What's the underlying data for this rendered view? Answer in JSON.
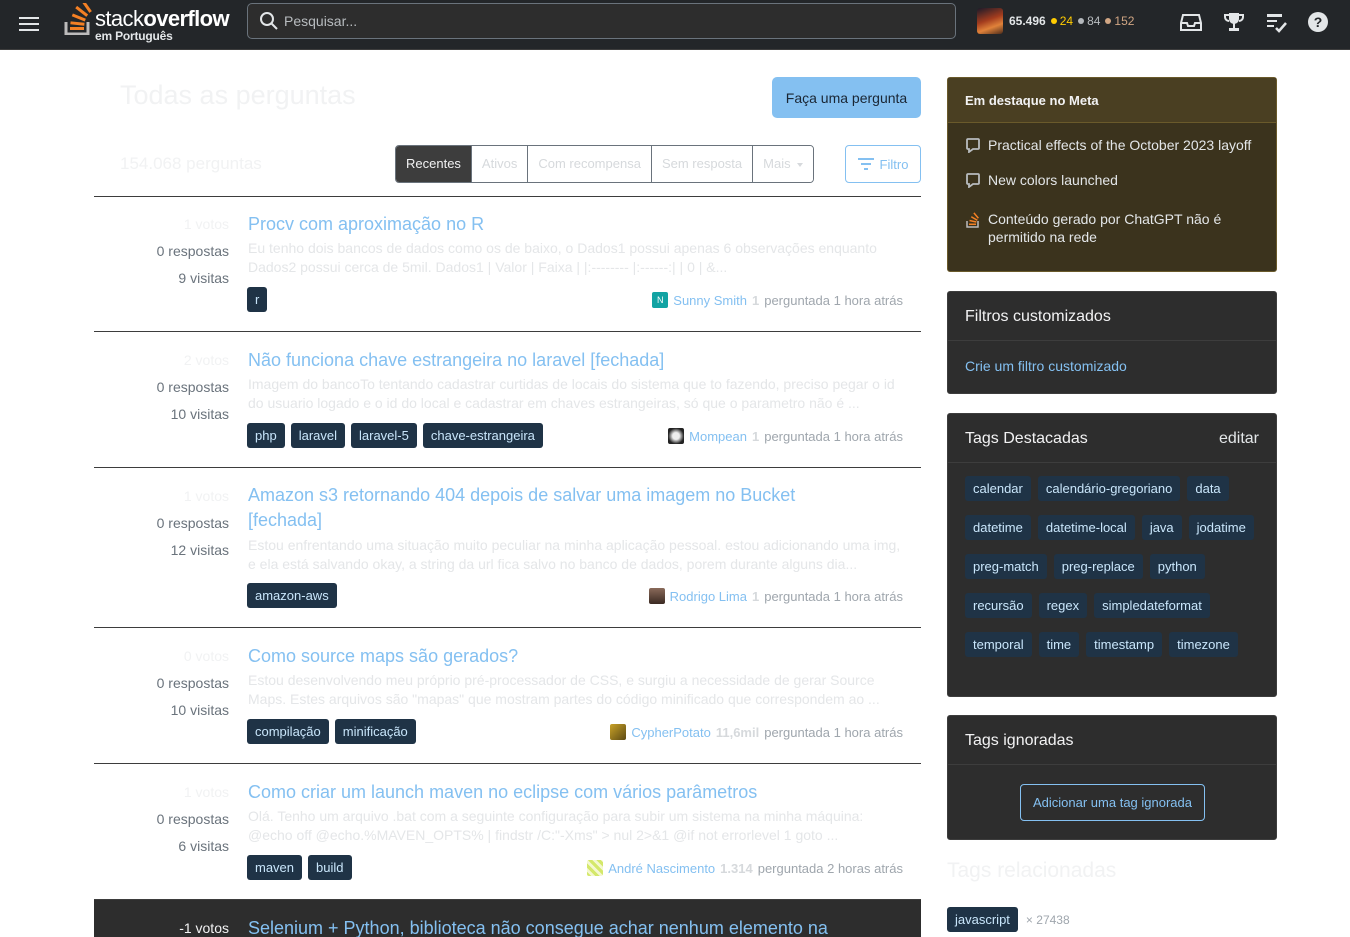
{
  "header": {
    "logo_stack": "stack",
    "logo_overflow": "overflow",
    "logo_sub": "em Português",
    "search_placeholder": "Pesquisar...",
    "user": {
      "reputation": "65.496",
      "gold": "24",
      "silver": "84",
      "bronze": "152"
    }
  },
  "main": {
    "title": "Todas as perguntas",
    "ask_button": "Faça uma pergunta",
    "count": "154.068 perguntas",
    "tabs": [
      "Recentes",
      "Ativos",
      "Com recompensa",
      "Sem resposta",
      "Mais"
    ],
    "filter_button": "Filtro"
  },
  "questions": [
    {
      "votes": "1 votos",
      "answers": "0 respostas",
      "views": "9 visitas",
      "title": "Procv com aproximação no R",
      "excerpt": "Eu tenho dois bancos de dados como os de baixo, o Dados1 possui apenas 6 observações enquanto Dados2 possui cerca de 5mil. Dados1 | Valor | Faixa | |:-------- |:------:| | 0 | &...",
      "tags": [
        "r"
      ],
      "user": "Sunny Smith",
      "user_rep": "1",
      "time": "perguntada 1 hora atrás"
    },
    {
      "votes": "2 votos",
      "answers": "0 respostas",
      "views": "10 visitas",
      "title": "Não funciona chave estrangeira no laravel [fechada]",
      "excerpt": "Imagem do bancoTo tentando cadastrar curtidas de locais do sistema que to fazendo, preciso pegar o id do usuario logado e o id do local e cadastrar em chaves estrangeiras, só que o parametro não é ...",
      "tags": [
        "php",
        "laravel",
        "laravel-5",
        "chave-estrangeira"
      ],
      "user": "Mompean",
      "user_rep": "1",
      "time": "perguntada 1 hora atrás"
    },
    {
      "votes": "1 votos",
      "answers": "0 respostas",
      "views": "12 visitas",
      "title": "Amazon s3 retornando 404 depois de salvar uma imagem no Bucket [fechada]",
      "excerpt": "Estou enfrentando uma situação muito peculiar na minha aplicação pessoal. estou adicionando uma img, e ela está salvando okay, a string da url fica salvo no banco de dados, porem durante alguns dia...",
      "tags": [
        "amazon-aws"
      ],
      "user": "Rodrigo Lima",
      "user_rep": "1",
      "time": "perguntada 1 hora atrás"
    },
    {
      "votes": "0 votos",
      "answers": "0 respostas",
      "views": "10 visitas",
      "title": "Como source maps são gerados?",
      "excerpt": "Estou desenvolvendo meu próprio pré-processador de CSS, e surgiu a necessidade de gerar Source Maps. Estes arquivos são \"mapas\" que mostram partes do código minificado que correspondem ao ...",
      "tags": [
        "compilação",
        "minificação"
      ],
      "user": "CypherPotato",
      "user_rep": "11,6mil",
      "time": "perguntada 1 hora atrás"
    },
    {
      "votes": "1 votos",
      "answers": "0 respostas",
      "views": "6 visitas",
      "title": "Como criar um launch maven no eclipse com vários parâmetros",
      "excerpt": "Olá. Tenho um arquivo .bat com a seguinte configuração para subir um sistema na minha máquina: @echo off @echo.%MAVEN_OPTS% | findstr /C:\"-Xms\" > nul 2>&1 @if not errorlevel 1 goto ...",
      "tags": [
        "maven",
        "build"
      ],
      "user": "André Nascimento",
      "user_rep": "1.314",
      "time": "perguntada 2 horas atrás"
    }
  ],
  "last_question": {
    "votes": "-1 votos",
    "title": "Selenium + Python, biblioteca não consegue achar nenhum elemento na"
  },
  "sidebar": {
    "meta": {
      "title": "Em destaque no Meta",
      "items": [
        "Practical effects of the October 2023 layoff",
        "New colors launched",
        "Conteúdo gerado por ChatGPT não é permitido na rede"
      ]
    },
    "custom_filters": {
      "title": "Filtros customizados",
      "link": "Crie um filtro customizado"
    },
    "featured_tags": {
      "title": "Tags Destacadas",
      "edit": "editar",
      "tags": [
        "calendar",
        "calendário-gregoriano",
        "data",
        "datetime",
        "datetime-local",
        "java",
        "jodatime",
        "preg-match",
        "preg-replace",
        "python",
        "recursão",
        "regex",
        "simpledateformat",
        "temporal",
        "time",
        "timestamp",
        "timezone"
      ]
    },
    "ignored_tags": {
      "title": "Tags ignoradas",
      "button": "Adicionar uma tag ignorada"
    },
    "related": {
      "title": "Tags relacionadas",
      "tag": "javascript",
      "count": "× 27438"
    }
  }
}
